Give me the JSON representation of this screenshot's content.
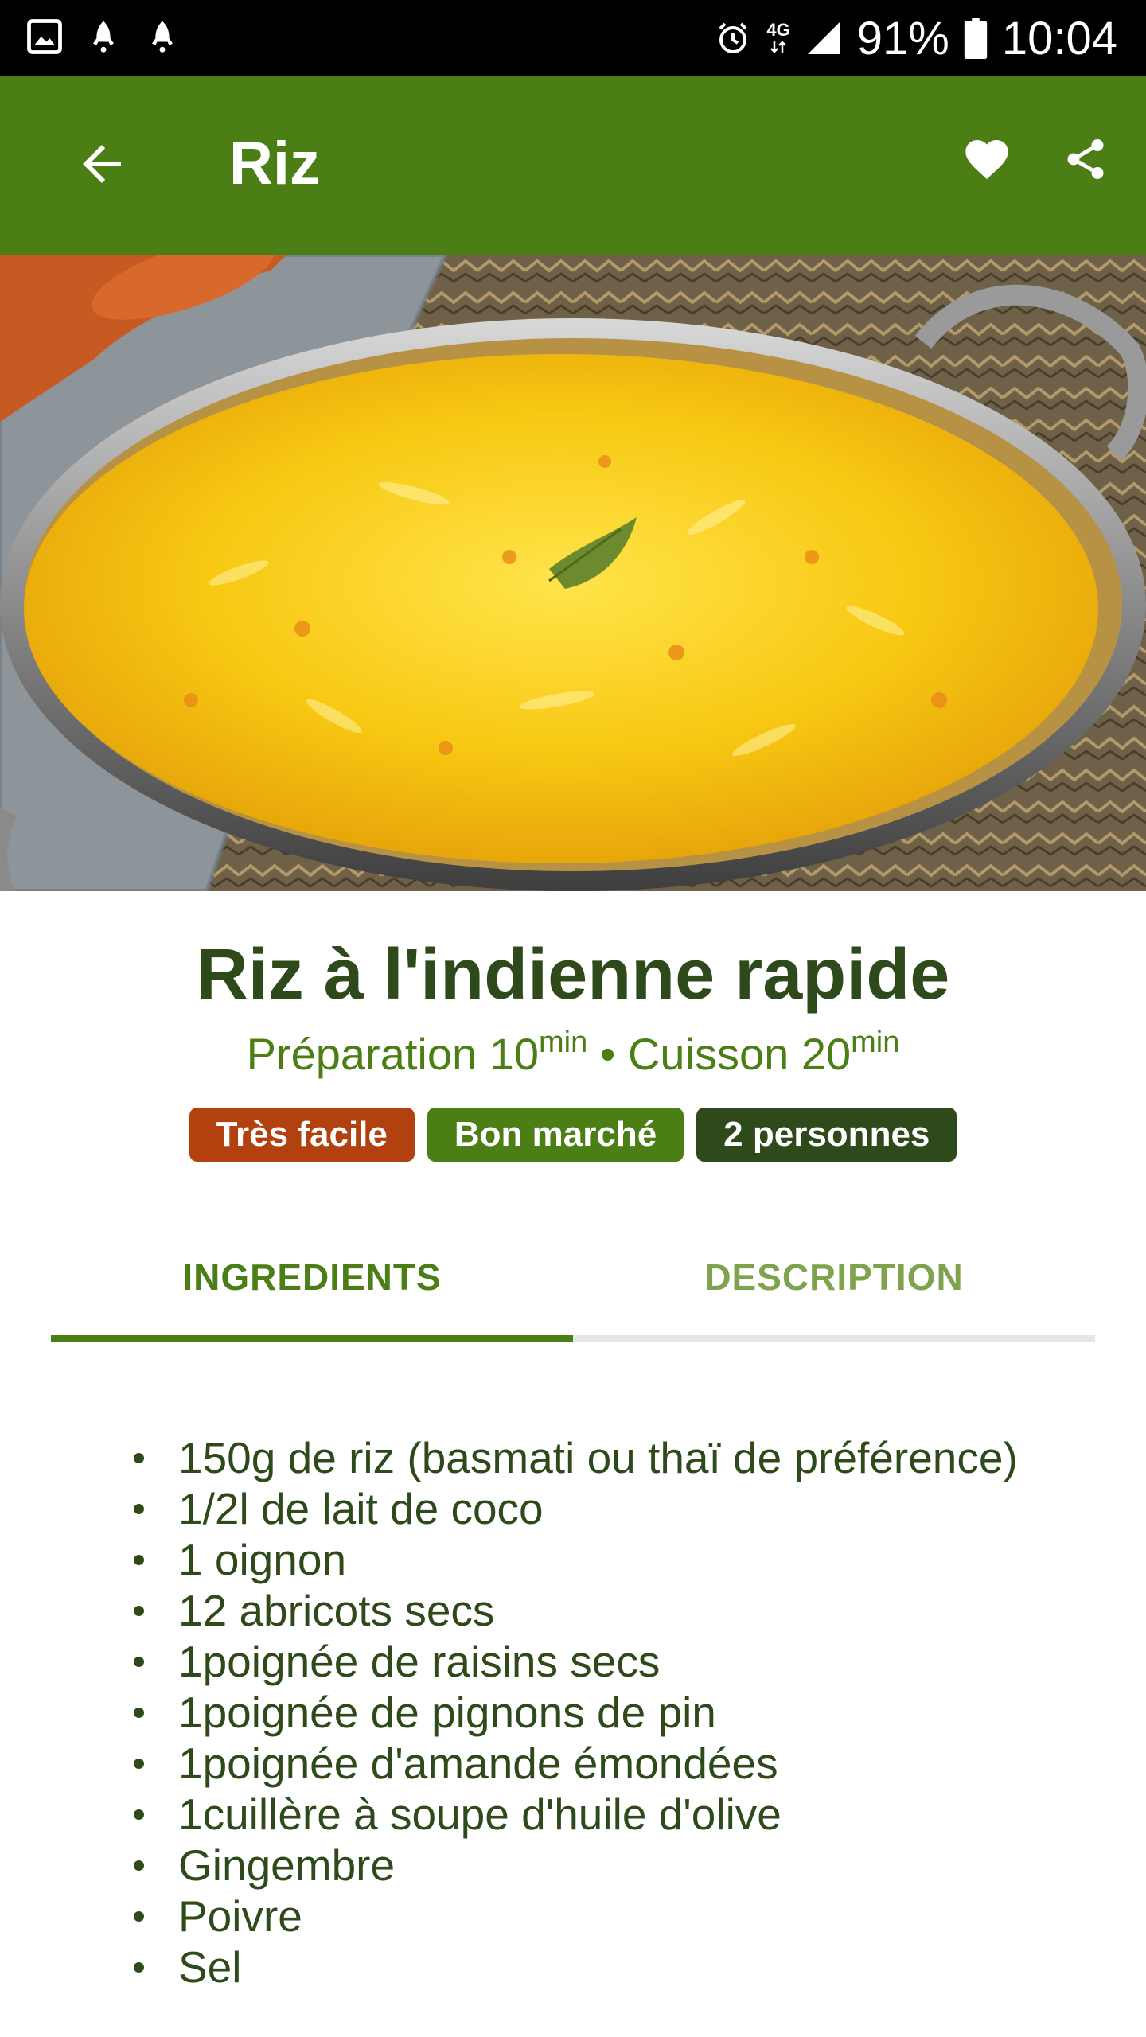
{
  "status_bar": {
    "network": "4G",
    "battery_percent": "91%",
    "time": "10:04",
    "icons": [
      "gallery-icon",
      "notification-icon",
      "notification-icon",
      "alarm-icon",
      "data-icon",
      "signal-icon",
      "battery-icon"
    ]
  },
  "app_bar": {
    "title": "Riz",
    "back_icon": "arrow-left-icon",
    "favorite_icon": "heart-icon",
    "share_icon": "share-icon",
    "background_color": "#4b7e15"
  },
  "hero": {
    "image": "yellow-rice-dish-photo"
  },
  "recipe": {
    "title": "Riz à l'indienne rapide",
    "prep_label": "Préparation 10",
    "prep_unit": "min",
    "separator": " • ",
    "cook_label": "Cuisson 20",
    "cook_unit": "min",
    "badges": {
      "difficulty": "Très facile",
      "cost": "Bon marché",
      "people": "2 personnes"
    },
    "colors": {
      "title": "#2e4a1a",
      "meta": "#4b7e15",
      "badge_difficulty": "#b3400f",
      "badge_cost": "#4b7e15",
      "badge_people": "#2e4a1a"
    }
  },
  "tabs": {
    "items": [
      {
        "label": "INGREDIENTS",
        "active": true
      },
      {
        "label": "DESCRIPTION",
        "active": false
      }
    ]
  },
  "ingredients": [
    "150g de riz (basmati ou thaï de préférence)",
    "1/2l de lait de coco",
    "1 oignon",
    "12 abricots secs",
    "1poignée de raisins secs",
    "1poignée de pignons de pin",
    "1poignée d'amande émondées",
    "1cuillère à soupe d'huile d'olive",
    "Gingembre",
    "Poivre",
    "Sel"
  ]
}
